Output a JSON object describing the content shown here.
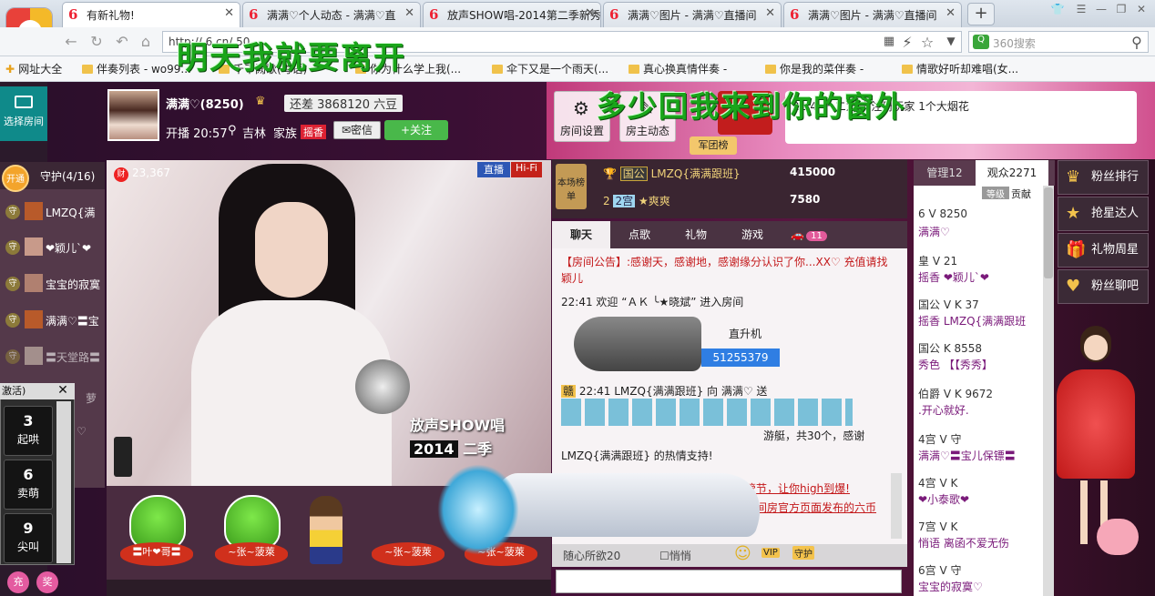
{
  "browser": {
    "tabs": [
      {
        "label": "有新礼物!"
      },
      {
        "label": "满满♡个人动态 - 满满♡直"
      },
      {
        "label": "放声SHOW唱-2014第二季新秀"
      },
      {
        "label": "满满♡图片 - 满满♡直播间"
      },
      {
        "label": "满满♡图片 - 满满♡直播间"
      }
    ],
    "new_tab": "+",
    "url": "http://            6.cn/     50",
    "search_placeholder": "360搜索",
    "search_badge": "Q",
    "bookmarks": [
      "网址大全",
      "伴奏列表 - wo99...",
      "千千阙歌(粤语)",
      "你为什么学上我(...",
      "伞下又是一个雨天(...",
      "真心换真情伴奏 -",
      "你是我的菜伴奏 -",
      "情歌好听却难唱(女..."
    ]
  },
  "overlay_text": {
    "line1": "明天我就要离开",
    "line2": "多少回我来到你的窗外"
  },
  "room": {
    "choose_room": "选择房间",
    "anchor_name": "满满♡(8250)",
    "next_level_text": "还差 3868120 六豆",
    "live_time": "开播 20:57",
    "location": "吉林",
    "family_label": "家族",
    "family_tag": "摇香",
    "secret_button": "密信",
    "follow_button": "+关注",
    "room_settings": "房间设置",
    "owner_feed": "房主动态",
    "army_rank": "军团榜",
    "notice": "21:4              十 二为  有注册玩家 1个大烟花"
  },
  "guard": {
    "open_badge": "开通",
    "title": "守护(4/16)",
    "members": [
      "LMZQ{满",
      "❤颖儿`❤",
      "宝宝的寂寞",
      "满满♡〓宝",
      "〓天堂路〓",
      "萝",
      "♡"
    ]
  },
  "video": {
    "fortune_icon": "财",
    "fortune_value": "23,367",
    "live_tag": "直播",
    "hifi_tag": "Hi-Fi",
    "event_logo": "放声SHOW唱",
    "event_year": "2014",
    "event_season": "二季"
  },
  "seats": [
    {
      "name": "〓叶❤哥〓"
    },
    {
      "name": "~张~菠萊"
    },
    {
      "name": "~张~菠萊"
    },
    {
      "name": "~张~菠萊"
    }
  ],
  "rank": {
    "badge": "本场榜单",
    "rows": [
      {
        "rank": "1",
        "badge": "国公",
        "name": "LMZQ{满满跟班}",
        "value": "415000"
      },
      {
        "rank": "2",
        "badge": "2宫",
        "name": "★爽爽",
        "value": "7580"
      }
    ]
  },
  "chat_tabs": [
    "聊天",
    "点歌",
    "礼物",
    "游戏",
    "11"
  ],
  "chat": {
    "announcement_label": "【房间公告】:",
    "announcement": "感谢天，感谢地，感谢缘分认识了你...XX♡ 充值请找颖儿",
    "welcome": "22:41 欢迎 “ＡＫ ╰★晓斌” 进入房间",
    "heli_label": "直升机",
    "heli_id": "51255379",
    "gift_line": "22:41 LMZQ{满满跟班} 向 满满♡ 送",
    "gift_end": "游艇，共30个，感谢",
    "gift_thanks": "LMZQ{满满跟班} 的热情支持!",
    "promo1": "说管节，让你high到爆!",
    "promo2": "第六间房官方页面发布的六币",
    "input_hint": "随心所欲20",
    "whisper": "悄悄"
  },
  "audience": {
    "admins_tab": "管理12",
    "viewers_tab": "观众2271",
    "sort1": "等级",
    "sort2": "贡献",
    "rows": [
      {
        "line1": "6 V 8250",
        "line2": "满满♡"
      },
      {
        "line1": "皇 V 21",
        "line2": "摇香 ❤颖儿`❤"
      },
      {
        "line1": "国公 V K 37",
        "line2": "摇香 LMZQ{满满跟班"
      },
      {
        "line1": "国公 K 8558",
        "line2": "秀色 【【秀秀】"
      },
      {
        "line1": "伯爵 V K 9672",
        "line2": ".开心就好."
      },
      {
        "line1": "4宫 V 守",
        "line2": "满满♡〓宝儿保镖〓"
      },
      {
        "line1": "4宫 V K",
        "line2": "❤小泰歌❤"
      },
      {
        "line1": "7宫 V K",
        "line2": "悄语 离函不爱无伤"
      },
      {
        "line1": "6宫 V 守",
        "line2": "宝宝的寂寞♡"
      }
    ]
  },
  "right_menu": [
    "粉丝排行",
    "抢星达人",
    "礼物周星",
    "粉丝聊吧"
  ],
  "popup": {
    "title": "激活)",
    "close": "✕",
    "buttons": [
      {
        "num": "3",
        "label": "起哄"
      },
      {
        "num": "6",
        "label": "卖萌"
      },
      {
        "num": "9",
        "label": "尖叫"
      }
    ]
  },
  "bottom_left": {
    "charge": "充",
    "award": "奖"
  },
  "colors": {
    "accent_green": "#49b84a",
    "chat_red": "#c3181a",
    "pink": "#e45ba0"
  }
}
